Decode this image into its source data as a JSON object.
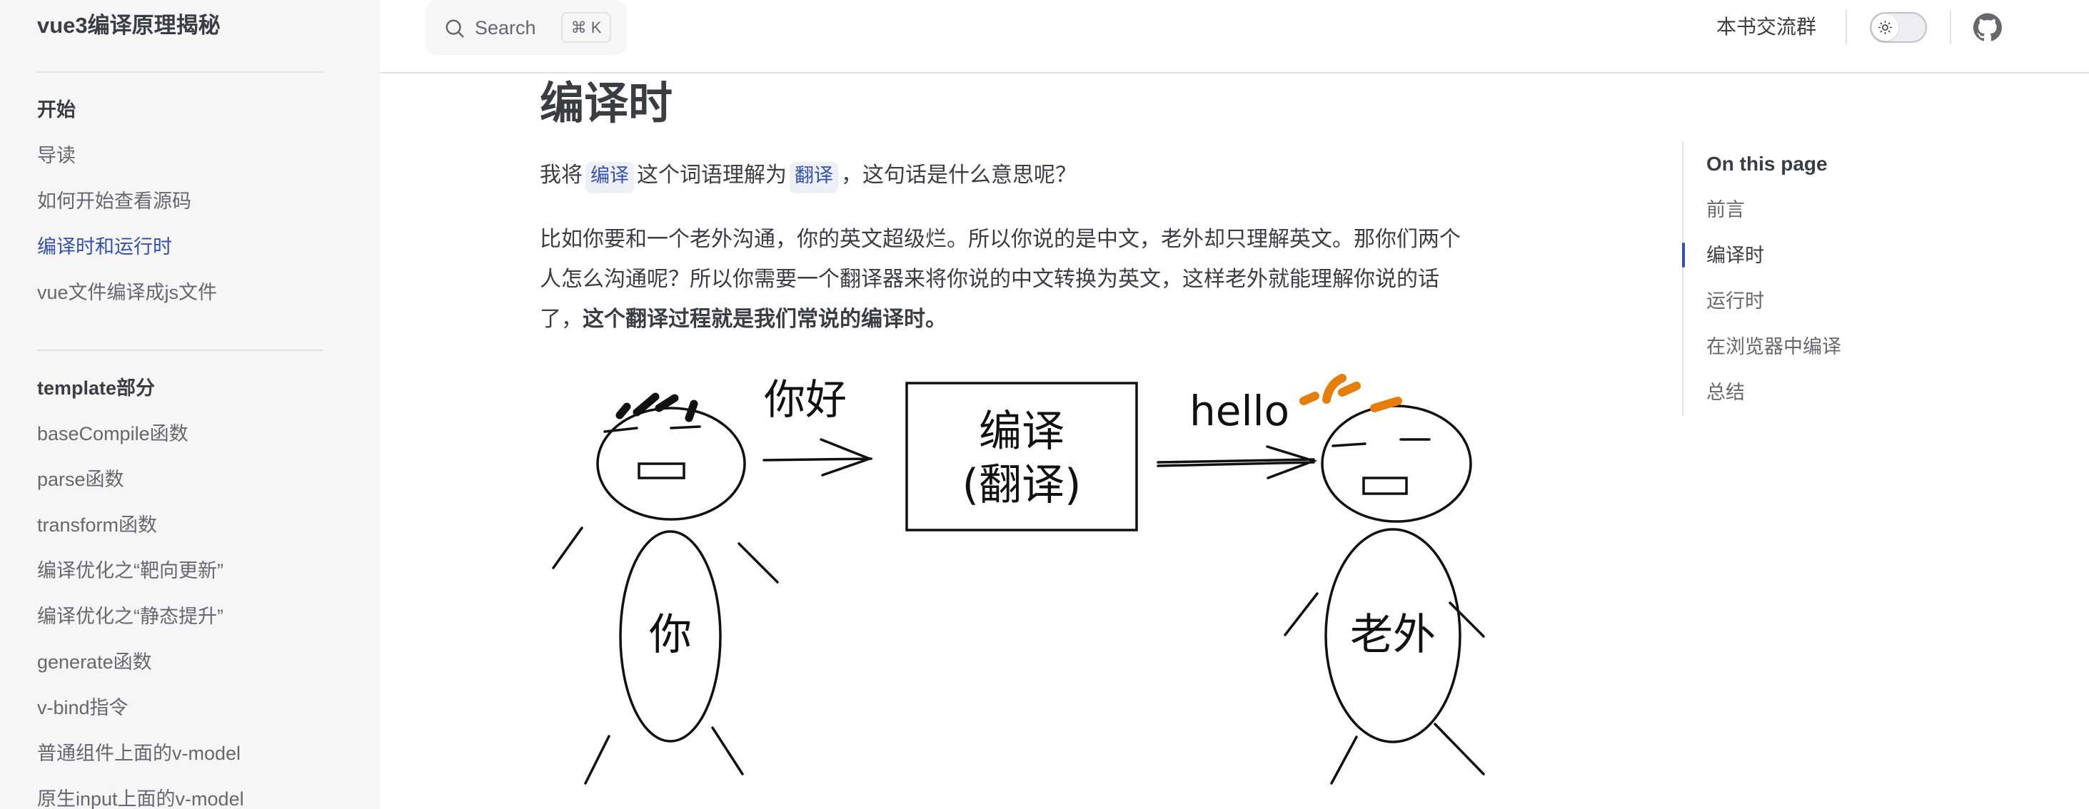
{
  "sidebar": {
    "site_title": "vue3编译原理揭秘",
    "groups": [
      {
        "title": "开始",
        "items": [
          {
            "label": "导读",
            "active": false
          },
          {
            "label": "如何开始查看源码",
            "active": false
          },
          {
            "label": "编译时和运行时",
            "active": true
          },
          {
            "label": "vue文件编译成js文件",
            "active": false
          }
        ]
      },
      {
        "title": "template部分",
        "items": [
          {
            "label": "baseCompile函数",
            "active": false
          },
          {
            "label": "parse函数",
            "active": false
          },
          {
            "label": "transform函数",
            "active": false
          },
          {
            "label": "编译优化之“靶向更新”",
            "active": false
          },
          {
            "label": "编译优化之“静态提升”",
            "active": false
          },
          {
            "label": "generate函数",
            "active": false
          },
          {
            "label": "v-bind指令",
            "active": false
          },
          {
            "label": "普通组件上面的v-model",
            "active": false
          },
          {
            "label": "原生input上面的v-model",
            "active": false
          }
        ]
      }
    ]
  },
  "navbar": {
    "search": {
      "label": "Search",
      "shortcut": "⌘ K",
      "icon": "search-icon"
    },
    "link_group": "本书交流群",
    "theme_toggle": {
      "icon": "sun-icon",
      "mode": "light"
    },
    "github": {
      "icon": "github-icon"
    }
  },
  "content": {
    "title": "编译时",
    "p1": {
      "t1": "我将",
      "code1": "编译",
      "t2": "这个词语理解为",
      "code2": "翻译",
      "t3": "，这句话是什么意思呢？"
    },
    "p2": {
      "line1": "比如你要和一个老外沟通，你的英文超级烂。所以你说的是中文，老外却只理解英文。那你们两个",
      "line2": "人怎么沟通呢？所以你需要一个翻译器来将你说的中文转换为英文，这样老外就能理解你说的话",
      "line3_plain": "了，",
      "line3_bold": "这个翻译过程就是我们常说的编译时。"
    },
    "illustration": {
      "left_person_label": "你",
      "left_speech": "你好",
      "box_line1": "编译",
      "box_line2": "(翻译)",
      "right_speech": "hello",
      "right_person_label": "老外",
      "accent_hair_color": "#e67e0a"
    }
  },
  "toc": {
    "title": "On this page",
    "items": [
      {
        "label": "前言",
        "active": false
      },
      {
        "label": "编译时",
        "active": true
      },
      {
        "label": "运行时",
        "active": false
      },
      {
        "label": "在浏览器中编译",
        "active": false
      },
      {
        "label": "总结",
        "active": false
      }
    ]
  },
  "colors": {
    "brand": "#3451b2",
    "sidebar_bg": "#f6f6f7",
    "text": "#3c3c43",
    "muted": "#67676c"
  }
}
